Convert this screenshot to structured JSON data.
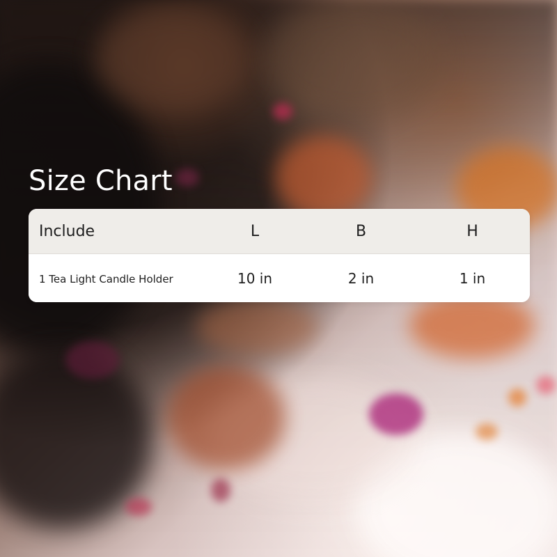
{
  "title": "Size Chart",
  "table": {
    "headers": [
      "Include",
      "L",
      "B",
      "H"
    ],
    "rows": [
      [
        "1 Tea Light Candle Holder",
        "10 in",
        "2 in",
        "1 in"
      ]
    ]
  },
  "colors": {
    "title_text": "#ffffff",
    "table_header_bg": "#efede9",
    "table_body_bg": "#ffffff",
    "table_text": "#1d1d1d"
  }
}
